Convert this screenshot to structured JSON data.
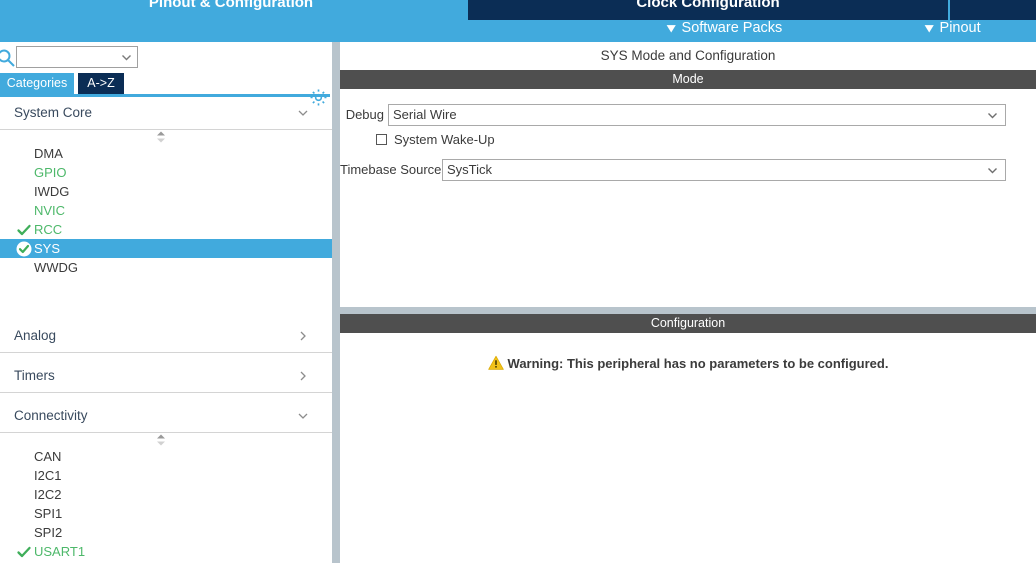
{
  "header": {
    "tabs": [
      {
        "label": "Pinout & Configuration",
        "active": true
      },
      {
        "label": "Clock Configuration",
        "active": false
      },
      {
        "label": "",
        "active": false
      }
    ],
    "actions": [
      {
        "label": "Software Packs",
        "icon": "chevron-down-icon"
      },
      {
        "label": "Pinout",
        "icon": "chevron-down-icon"
      }
    ]
  },
  "sidebar": {
    "search": {
      "value": "",
      "placeholder": "",
      "icon": "search-icon",
      "dropdown_icon": "chevron-down-icon"
    },
    "settings_icon": "gear-icon",
    "view_tabs": [
      {
        "label": "Categories",
        "selected": true
      },
      {
        "label": "A->Z",
        "selected": false
      }
    ],
    "groups": [
      {
        "title": "System Core",
        "expanded": true,
        "chevron": "chevron-down-icon",
        "items": [
          {
            "label": "DMA",
            "state": "none",
            "checked": false
          },
          {
            "label": "GPIO",
            "state": "configured",
            "checked": false
          },
          {
            "label": "IWDG",
            "state": "none",
            "checked": false
          },
          {
            "label": "NVIC",
            "state": "configured",
            "checked": false
          },
          {
            "label": "RCC",
            "state": "configured",
            "checked": true
          },
          {
            "label": "SYS",
            "state": "selected",
            "checked": true
          },
          {
            "label": "WWDG",
            "state": "none",
            "checked": false
          }
        ]
      },
      {
        "title": "Analog",
        "expanded": false,
        "chevron": "chevron-right-icon",
        "items": []
      },
      {
        "title": "Timers",
        "expanded": false,
        "chevron": "chevron-right-icon",
        "items": []
      },
      {
        "title": "Connectivity",
        "expanded": true,
        "chevron": "chevron-down-icon",
        "items": [
          {
            "label": "CAN",
            "state": "none",
            "checked": false
          },
          {
            "label": "I2C1",
            "state": "none",
            "checked": false
          },
          {
            "label": "I2C2",
            "state": "none",
            "checked": false
          },
          {
            "label": "SPI1",
            "state": "none",
            "checked": false
          },
          {
            "label": "SPI2",
            "state": "none",
            "checked": false
          },
          {
            "label": "USART1",
            "state": "configured",
            "checked": true
          }
        ]
      }
    ]
  },
  "main": {
    "title": "SYS Mode and Configuration",
    "mode": {
      "section_label": "Mode",
      "debug": {
        "label": "Debug",
        "value": "Serial Wire",
        "chevron": "chevron-down-icon"
      },
      "system_wakeup": {
        "label": "System Wake-Up",
        "checked": false
      },
      "timebase": {
        "label": "Timebase Source",
        "value": "SysTick",
        "chevron": "chevron-down-icon"
      }
    },
    "configuration": {
      "section_label": "Configuration",
      "warning_icon": "warning-triangle-icon",
      "warning_text": "Warning: This peripheral has no parameters to be configured."
    }
  },
  "colors": {
    "accent_blue": "#41aadd",
    "tab_navy": "#0b2d55",
    "section_gray": "#4f4f4f",
    "splitter": "#b8c4cc",
    "green": "#4db86a",
    "warning_yellow": "#f2c21a"
  }
}
